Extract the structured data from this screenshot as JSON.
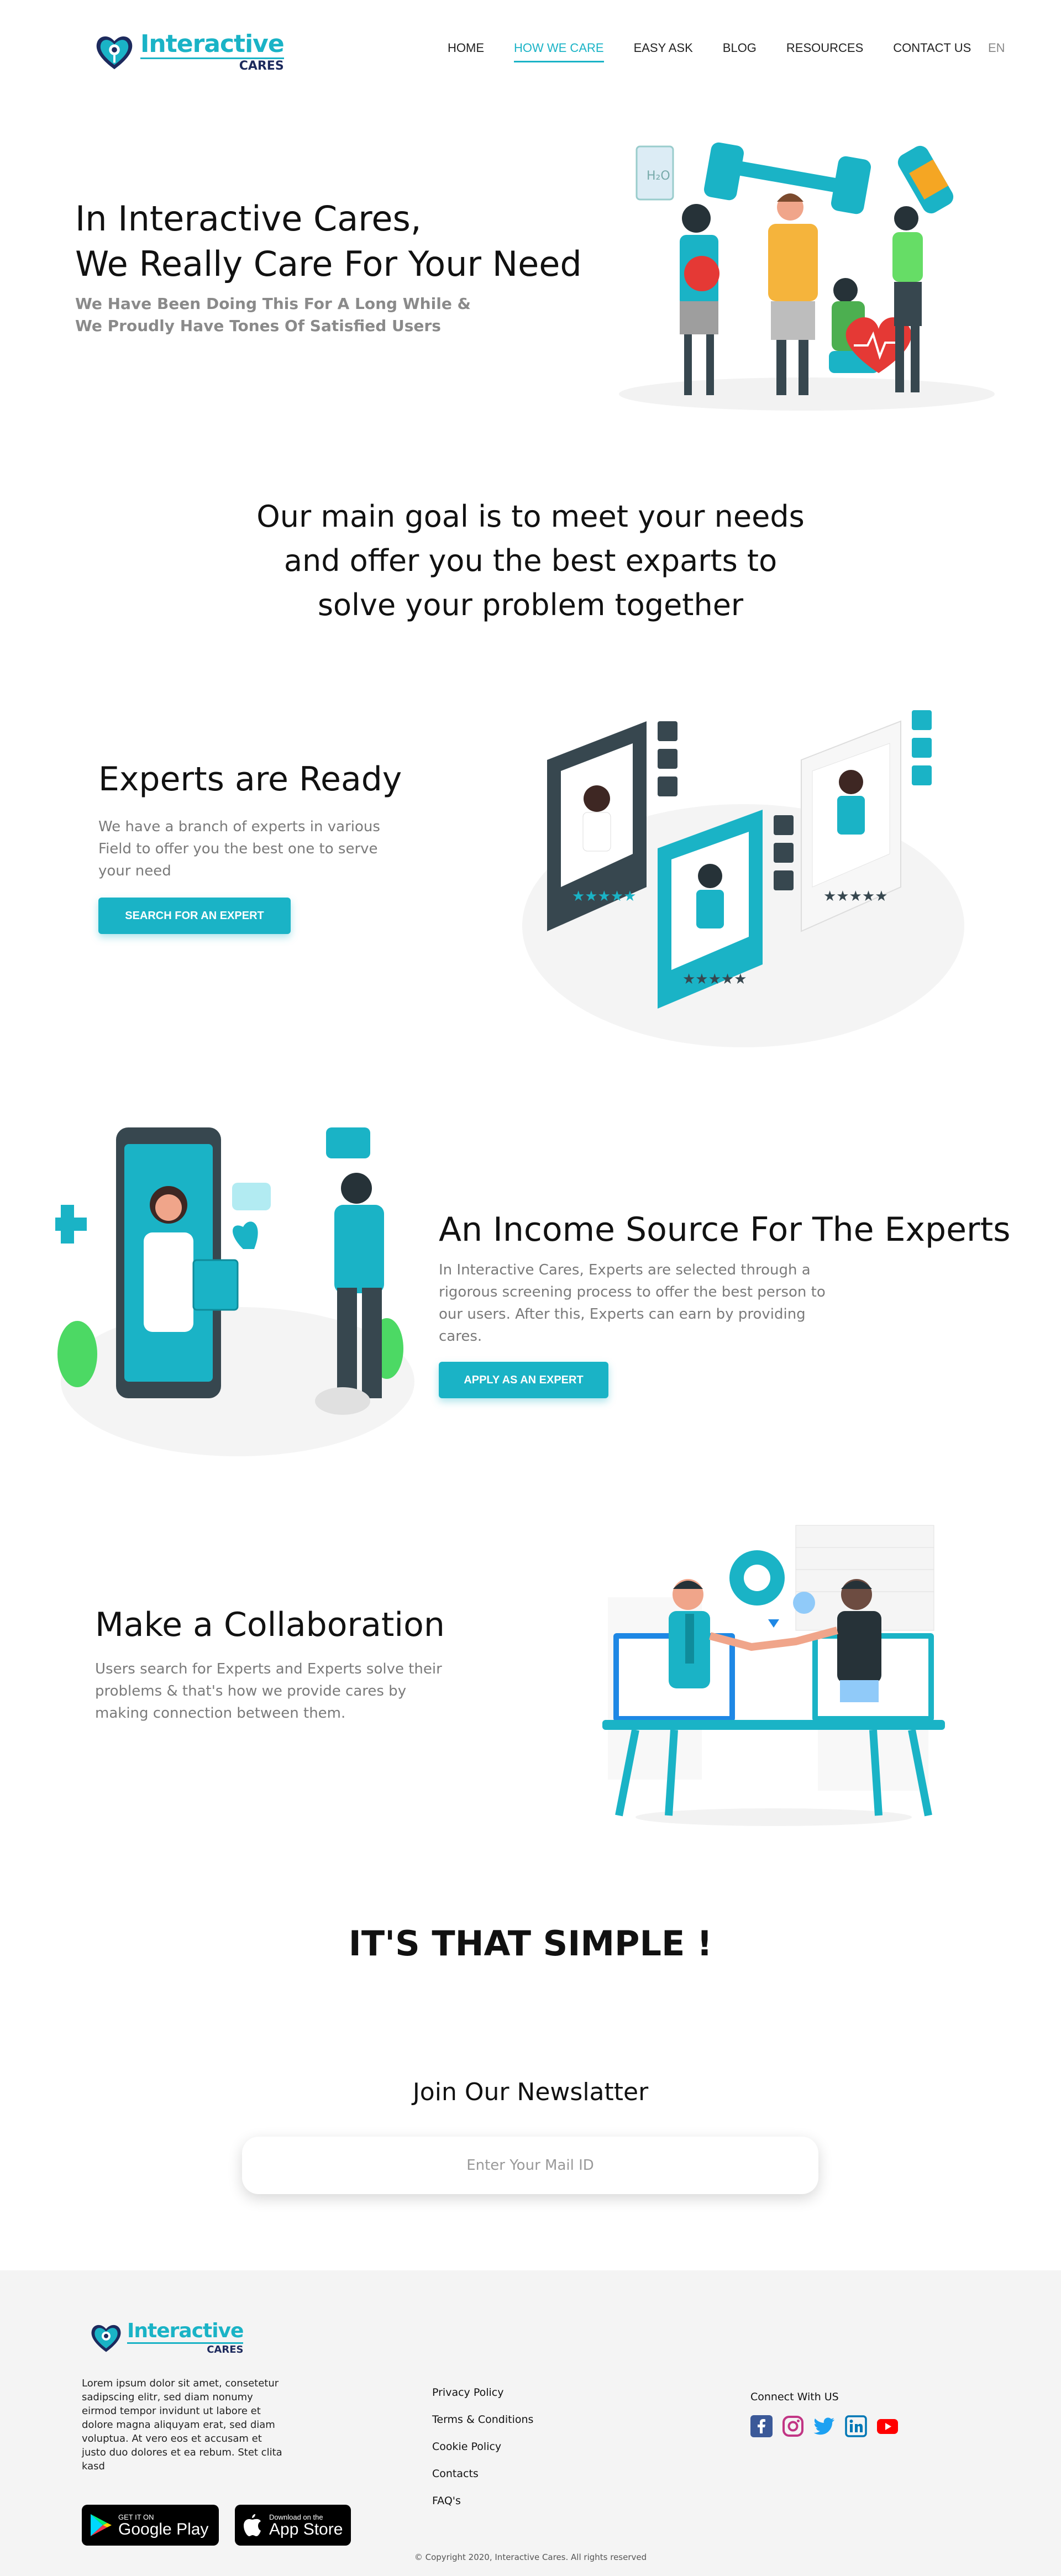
{
  "brand": {
    "name_line1": "Interactive",
    "name_line2": "CARES",
    "accent": "#1ab3c6",
    "navy": "#1d2a5d"
  },
  "nav": {
    "items": [
      {
        "label": "HOME",
        "active": false
      },
      {
        "label": "HOW WE CARE",
        "active": true
      },
      {
        "label": "EASY ASK",
        "active": false
      },
      {
        "label": "BLOG",
        "active": false
      },
      {
        "label": "RESOURCES",
        "active": false
      },
      {
        "label": "CONTACT US",
        "active": false
      }
    ],
    "language": "EN"
  },
  "hero": {
    "title_line1": "In Interactive Cares,",
    "title_line2": "We Really Care For Your Need",
    "subtitle_line1": "We Have Been Doing This For A Long While &",
    "subtitle_line2": "We Proudly Have Tones Of Satisfied Users",
    "illustration": "people-health-fitness-illustration"
  },
  "goal": {
    "line1": "Our main goal is to meet your needs",
    "line2": "and offer you the best exparts to",
    "line3": "solve your problem together"
  },
  "experts": {
    "title": "Experts are Ready",
    "text_line1": "We have a branch of experts in various",
    "text_line2": "Field to offer you the best one to serve",
    "text_line3": "your need",
    "button": "SEARCH FOR AN EXPERT",
    "illustration": "expert-profile-cards-illustration"
  },
  "income": {
    "title": "An Income Source For The Experts",
    "text_line1": "In Interactive Cares, Experts are selected through a",
    "text_line2": "rigorous screening process to offer the best person to",
    "text_line3": "our users. After this, Experts can earn by providing",
    "text_line4": "cares.",
    "button": "APPLY AS AN EXPERT",
    "illustration": "doctor-video-call-illustration"
  },
  "collab": {
    "title": "Make a Collaboration",
    "text_line1": "Users search for Experts and Experts solve their",
    "text_line2": "problems & that's how we provide cares by",
    "text_line3": "making connection between them.",
    "illustration": "handshake-collaboration-illustration"
  },
  "simple": {
    "text": "IT'S THAT SIMPLE !"
  },
  "newsletter": {
    "title": "Join Our Newslatter",
    "placeholder": "Enter Your Mail ID"
  },
  "footer": {
    "about_line1": "Lorem ipsum dolor sit amet, consetetur",
    "about_line2": "sadipscing elitr, sed diam nonumy",
    "about_line3": "eirmod tempor invidunt ut labore et",
    "about_line4": "dolore magna aliquyam erat, sed diam",
    "about_line5": "voluptua. At vero eos et accusam et",
    "about_line6": "justo duo dolores et ea rebum. Stet clita",
    "about_line7": "kasd",
    "google_play_small": "GET IT ON",
    "google_play_big": "Google Play",
    "app_store_small": "Download on the",
    "app_store_big": "App Store",
    "links": [
      "Privacy Policy",
      "Terms & Conditions",
      "Cookie Policy",
      "Contacts",
      "FAQ's"
    ],
    "connect_title": "Connect With US",
    "socials": [
      "facebook-icon",
      "instagram-icon",
      "twitter-icon",
      "linkedin-icon",
      "youtube-icon"
    ],
    "copyright": "© Copyright 2020, Interactive Cares. All rights reserved"
  }
}
